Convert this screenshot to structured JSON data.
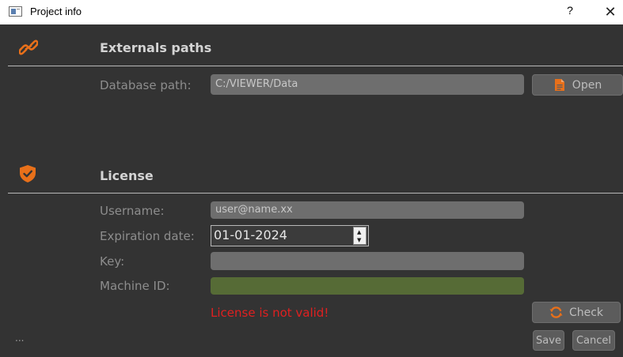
{
  "window": {
    "title": "Project info",
    "help_label": "?",
    "close_label": "✕"
  },
  "externals": {
    "title": "Externals paths",
    "database_label": "Database path:",
    "database_value": "C:/VIEWER/Data",
    "open_label": "Open"
  },
  "license": {
    "title": "License",
    "username_label": "Username:",
    "username_value": "user@name.xx",
    "expiration_label": "Expiration date:",
    "expiration_value": "01-01-2024",
    "key_label": "Key:",
    "key_value": "",
    "machine_label": "Machine ID:",
    "machine_value": "",
    "status_text": "License is not valid!",
    "check_label": "Check"
  },
  "footer": {
    "dots": "...",
    "save_label": "Save",
    "cancel_label": "Cancel"
  },
  "colors": {
    "accent": "#e8701a",
    "error": "#e02020",
    "machine_field": "#566b36",
    "background": "#333333"
  }
}
